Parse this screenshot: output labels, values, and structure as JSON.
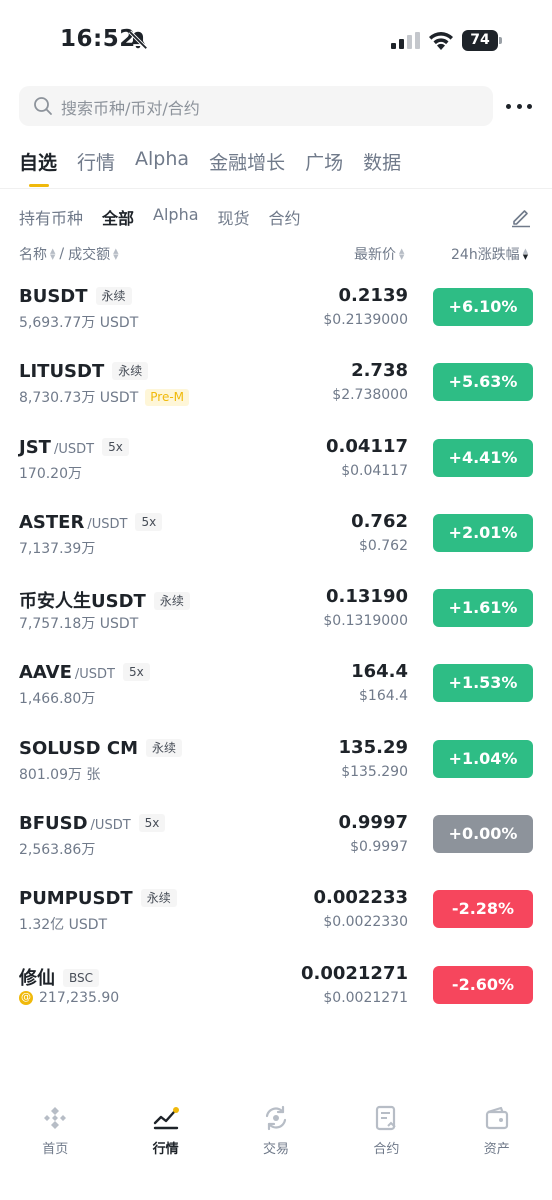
{
  "status": {
    "time": "16:52",
    "battery": "74"
  },
  "search": {
    "placeholder": "搜索币种/币对/合约"
  },
  "main_tabs": [
    "自选",
    "行情",
    "Alpha",
    "金融增长",
    "广场",
    "数据"
  ],
  "sub_tabs": [
    "持有币种",
    "全部",
    "Alpha",
    "现货",
    "合约"
  ],
  "columns": {
    "name": "名称",
    "sep": "/",
    "volume": "成交额",
    "price": "最新价",
    "change": "24h涨跌幅"
  },
  "rows": [
    {
      "name": "BUSDT",
      "quote": "",
      "tag": "永续",
      "volume": "5,693.77万 USDT",
      "badge": "",
      "price": "0.2139",
      "fiat": "$0.2139000",
      "change": "+6.10%",
      "dir": "up"
    },
    {
      "name": "LITUSDT",
      "quote": "",
      "tag": "永续",
      "volume": "8,730.73万 USDT",
      "badge": "Pre-M",
      "price": "2.738",
      "fiat": "$2.738000",
      "change": "+5.63%",
      "dir": "up"
    },
    {
      "name": "JST",
      "quote": "/USDT",
      "tag": "5x",
      "volume": "170.20万",
      "badge": "",
      "price": "0.04117",
      "fiat": "$0.04117",
      "change": "+4.41%",
      "dir": "up"
    },
    {
      "name": "ASTER",
      "quote": "/USDT",
      "tag": "5x",
      "volume": "7,137.39万",
      "badge": "",
      "price": "0.762",
      "fiat": "$0.762",
      "change": "+2.01%",
      "dir": "up"
    },
    {
      "name": "币安人生USDT",
      "quote": "",
      "tag": "永续",
      "volume": "7,757.18万 USDT",
      "badge": "",
      "price": "0.13190",
      "fiat": "$0.1319000",
      "change": "+1.61%",
      "dir": "up"
    },
    {
      "name": "AAVE",
      "quote": "/USDT",
      "tag": "5x",
      "volume": "1,466.80万",
      "badge": "",
      "price": "164.4",
      "fiat": "$164.4",
      "change": "+1.53%",
      "dir": "up"
    },
    {
      "name": "SOLUSD CM",
      "quote": "",
      "tag": "永续",
      "volume": "801.09万 张",
      "badge": "",
      "price": "135.29",
      "fiat": "$135.290",
      "change": "+1.04%",
      "dir": "up"
    },
    {
      "name": "BFUSD",
      "quote": "/USDT",
      "tag": "5x",
      "volume": "2,563.86万",
      "badge": "",
      "price": "0.9997",
      "fiat": "$0.9997",
      "change": "+0.00%",
      "dir": "flat"
    },
    {
      "name": "PUMPUSDT",
      "quote": "",
      "tag": "永续",
      "volume": "1.32亿 USDT",
      "badge": "",
      "price": "0.002233",
      "fiat": "$0.0022330",
      "change": "-2.28%",
      "dir": "down"
    },
    {
      "name": "修仙",
      "quote": "",
      "tag": "BSC",
      "volume": "217,235.90",
      "badge": "",
      "coin_icon": "@",
      "price": "0.0021271",
      "fiat": "$0.0021271",
      "change": "-2.60%",
      "dir": "down"
    }
  ],
  "bottom_nav": [
    {
      "label": "首页",
      "icon": "home-icon",
      "active": false
    },
    {
      "label": "行情",
      "icon": "markets-icon",
      "active": true
    },
    {
      "label": "交易",
      "icon": "trade-icon",
      "active": false
    },
    {
      "label": "合约",
      "icon": "futures-icon",
      "active": false
    },
    {
      "label": "资产",
      "icon": "wallet-icon",
      "active": false
    }
  ],
  "colors": {
    "up": "#2ebd85",
    "down": "#f6465d",
    "flat": "#8d939b",
    "accent": "#f0b90b"
  }
}
